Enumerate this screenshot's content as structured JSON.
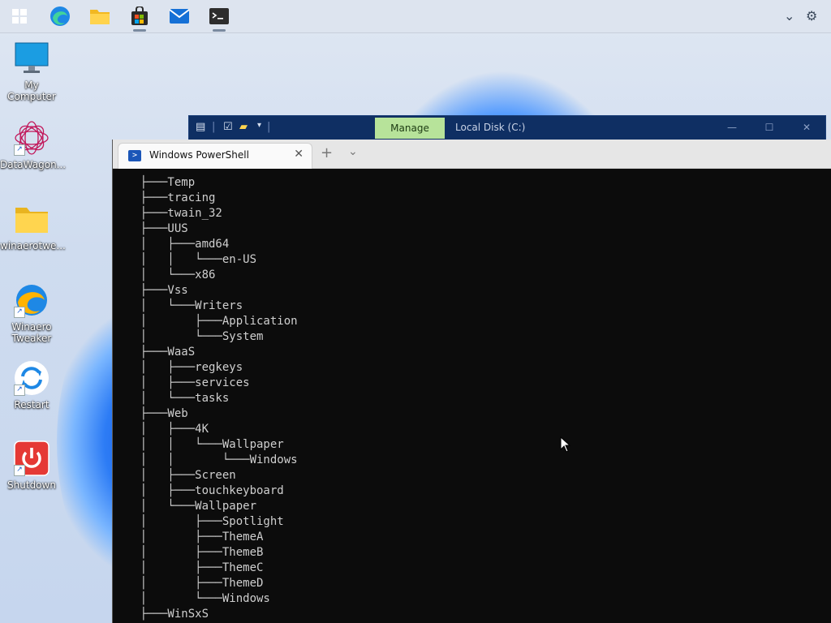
{
  "desktop": {
    "icons": [
      {
        "label": "My Computer",
        "icon": "monitor-icon",
        "shortcut": false
      },
      {
        "label": "DataWagon...",
        "icon": "spirograph-icon",
        "shortcut": true
      },
      {
        "label": "winaerotwe...",
        "icon": "folder-icon",
        "shortcut": false
      },
      {
        "label": "Winaero\nTweaker",
        "icon": "edge-like-icon",
        "shortcut": true
      },
      {
        "label": "Restart",
        "icon": "restart-icon",
        "shortcut": true
      },
      {
        "label": "Shutdown",
        "icon": "power-icon",
        "shortcut": true
      }
    ]
  },
  "taskbar": {
    "apps": [
      "start-icon",
      "edge-icon",
      "file-explorer-icon",
      "store-icon",
      "mail-icon",
      "terminal-icon"
    ],
    "tray": [
      "chevron-down-icon",
      "gear-icon"
    ]
  },
  "explorer": {
    "ribbon_tab": "Manage",
    "title": "Local Disk (C:)"
  },
  "powershell": {
    "tab_title": "Windows PowerShell",
    "lines": [
      "    ├───Temp",
      "    ├───tracing",
      "    ├───twain_32",
      "    ├───UUS",
      "    │   ├───amd64",
      "    │   │   └───en-US",
      "    │   └───x86",
      "    ├───Vss",
      "    │   └───Writers",
      "    │       ├───Application",
      "    │       └───System",
      "    ├───WaaS",
      "    │   ├───regkeys",
      "    │   ├───services",
      "    │   └───tasks",
      "    ├───Web",
      "    │   ├───4K",
      "    │   │   └───Wallpaper",
      "    │   │       └───Windows",
      "    │   ├───Screen",
      "    │   ├───touchkeyboard",
      "    │   └───Wallpaper",
      "    │       ├───Spotlight",
      "    │       ├───ThemeA",
      "    │       ├───ThemeB",
      "    │       ├───ThemeC",
      "    │       ├───ThemeD",
      "    │       └───Windows",
      "    ├───WinSxS"
    ]
  }
}
